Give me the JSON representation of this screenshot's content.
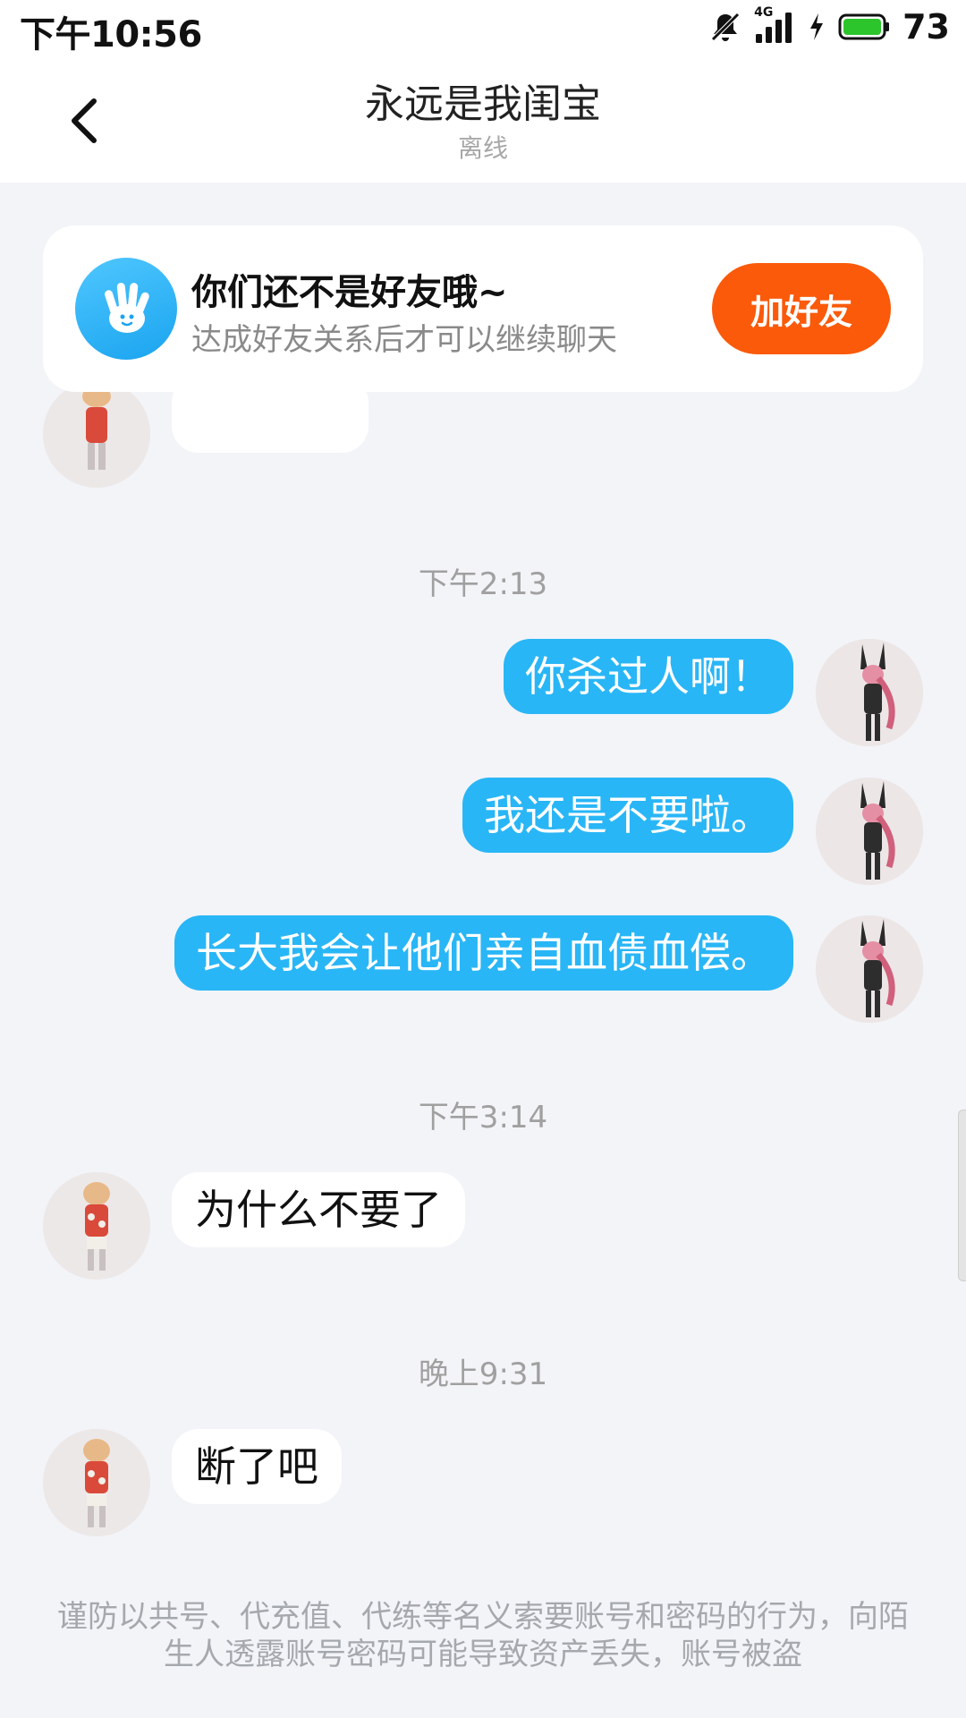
{
  "status_bar": {
    "time": "下午10:56",
    "network_label": "4G",
    "battery_level": "73"
  },
  "header": {
    "title": "永远是我闺宝",
    "status": "离线"
  },
  "friend_card": {
    "title": "你们还不是好友哦~",
    "description": "达成好友关系后才可以继续聊天",
    "button_label": "加好友"
  },
  "messages": [
    {
      "type": "timestamp",
      "text": "下午2:13"
    },
    {
      "type": "out",
      "text": "你杀过人啊！"
    },
    {
      "type": "out",
      "text": "我还是不要啦。"
    },
    {
      "type": "out",
      "text": "长大我会让他们亲自血债血偿。"
    },
    {
      "type": "timestamp",
      "text": "下午3:14"
    },
    {
      "type": "in",
      "text": "为什么不要了"
    },
    {
      "type": "timestamp",
      "text": "晚上9:31"
    },
    {
      "type": "in",
      "text": "断了吧"
    }
  ],
  "warning": "谨防以共号、代充值、代练等名义索要账号和密码的行为，向陌生人透露账号密码可能导致资产丢失，账号被盗",
  "colors": {
    "accent": "#29b6f6",
    "add_button": "#fa5a0a",
    "background": "#f3f4f8"
  },
  "icons": {
    "back": "chevron-left-icon",
    "wave": "hand-wave-icon",
    "mute": "bell-off-icon",
    "signal": "signal-icon",
    "charging": "bolt-icon",
    "battery": "battery-icon"
  }
}
